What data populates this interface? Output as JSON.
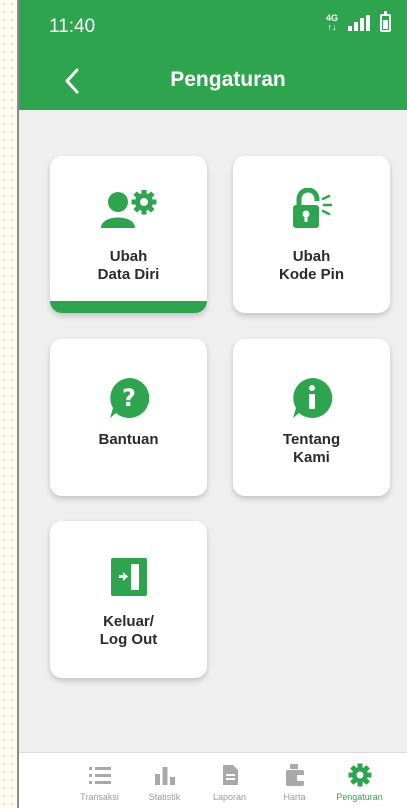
{
  "status": {
    "time": "11:40",
    "network": "4G"
  },
  "header": {
    "title": "Pengaturan"
  },
  "cards": [
    {
      "label": "Ubah\nData Diri"
    },
    {
      "label": "Ubah\nKode Pin"
    },
    {
      "label": "Bantuan"
    },
    {
      "label": "Tentang\nKami"
    },
    {
      "label": "Keluar/\nLog Out"
    }
  ],
  "nav": [
    {
      "label": "Transaksi",
      "icon": "list-icon"
    },
    {
      "label": "Statistik",
      "icon": "bar-chart-icon"
    },
    {
      "label": "Laporan",
      "icon": "document-icon"
    },
    {
      "label": "Harta",
      "icon": "wallet-icon"
    },
    {
      "label": "Pengaturan",
      "icon": "gear-icon"
    }
  ],
  "colors": {
    "accent": "#2ea44f",
    "inactive": "#9b9b9b",
    "background": "#efefef"
  }
}
